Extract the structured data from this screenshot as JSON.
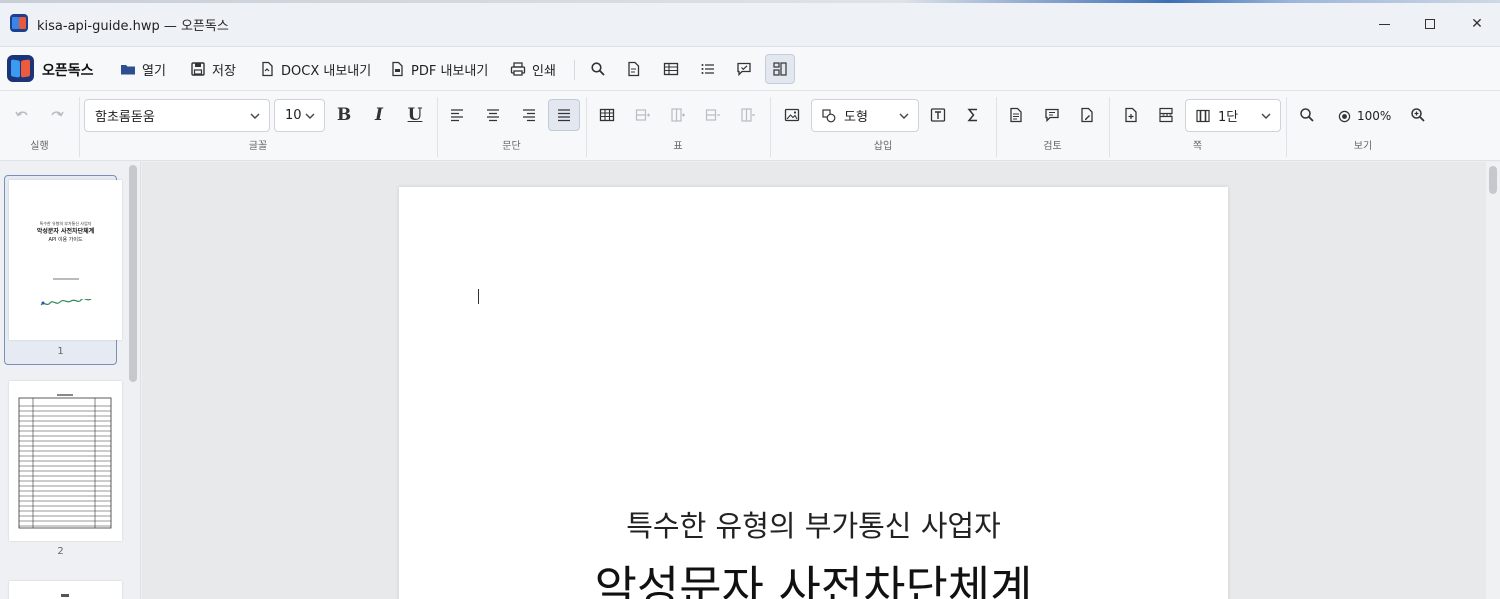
{
  "window": {
    "title": "kisa-api-guide.hwp — 오픈독스",
    "minimize_icon": "minimize-icon",
    "maximize_icon": "maximize-icon",
    "close_label": "✕"
  },
  "toolbar": {
    "brand": "오픈독스",
    "open": "열기",
    "save": "저장",
    "export_docx": "DOCX 내보내기",
    "export_pdf": "PDF 내보내기",
    "print": "인쇄"
  },
  "ribbon": {
    "groups": {
      "run": "실행",
      "font": "글꼴",
      "paragraph": "문단",
      "table": "표",
      "insert": "삽입",
      "review": "검토",
      "page": "쪽",
      "view": "보기"
    },
    "font_name": "함초롬돋움",
    "font_size": "10",
    "bold": "B",
    "italic": "I",
    "underline": "U",
    "shape": "도형",
    "columns": "1단",
    "zoom": "100%"
  },
  "thumbnails": [
    {
      "number": "1",
      "lines": [
        "특수한 유형의 부가통신 사업자",
        "악성문자 사전차단체계",
        "API 이용 가이드"
      ]
    },
    {
      "number": "2"
    }
  ],
  "document": {
    "subtitle": "특수한 유형의 부가통신 사업자",
    "title": "악성문자 사전차단체계"
  },
  "colors": {
    "accent": "#1b3477",
    "brand_blue": "#3b9bf0",
    "brand_red": "#ee5b3c"
  }
}
